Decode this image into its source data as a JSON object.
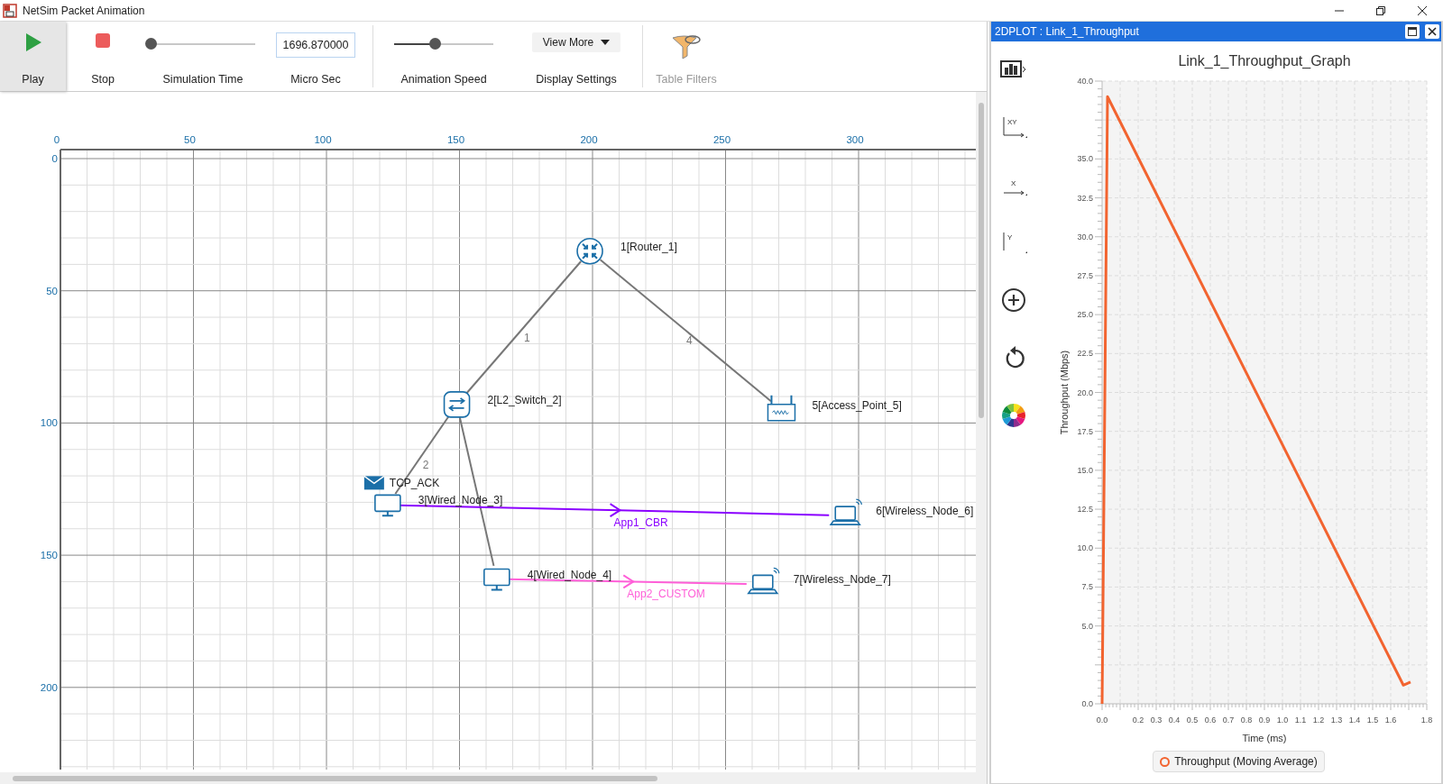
{
  "window": {
    "title": "NetSim Packet Animation"
  },
  "toolbar": {
    "play": {
      "label": "Play",
      "selected": true
    },
    "stop": {
      "label": "Stop"
    },
    "simulation_time": {
      "label": "Simulation Time",
      "level": 0
    },
    "time_field": {
      "value": "1696.870000",
      "unit": "Micro Sec"
    },
    "animation_speed": {
      "label": "Animation Speed",
      "level": 0.41
    },
    "display_settings": {
      "button": "View More",
      "label": "Display Settings"
    },
    "table_filters": {
      "label": "Table Filters",
      "disabled": true
    }
  },
  "canvas": {
    "x_ruler": [
      "0",
      "50",
      "100",
      "150",
      "200",
      "250",
      "300"
    ],
    "y_ruler": [
      "0",
      "50",
      "100",
      "150",
      "200"
    ],
    "nodes": [
      {
        "kind": "router",
        "label": "1[Router_1]"
      },
      {
        "kind": "switch",
        "label": "2[L2_Switch_2]"
      },
      {
        "kind": "wired_node",
        "label": "3[Wired_Node_3]"
      },
      {
        "kind": "wired_node",
        "label": "4[Wired_Node_4]"
      },
      {
        "kind": "access_point",
        "label": "5[Access_Point_5]"
      },
      {
        "kind": "wireless_node",
        "label": "6[Wireless_Node_6]"
      },
      {
        "kind": "wireless_node",
        "label": "7[Wireless_Node_7]"
      }
    ],
    "links": [
      {
        "label": "1"
      },
      {
        "label": "4"
      },
      {
        "label": "2"
      }
    ],
    "applications": [
      {
        "name": "App1_CBR",
        "color": "#8b00ff"
      },
      {
        "name": "App2_CUSTOM",
        "color": "#ff5fd8"
      }
    ],
    "packets": [
      {
        "label": "TCP_ACK"
      }
    ]
  },
  "plot_window": {
    "title": "2DPLOT : Link_1_Throughput",
    "tools": [
      {
        "kind": "bar_chart"
      },
      {
        "kind": "xy_axis",
        "label": "XY"
      },
      {
        "kind": "x_axis",
        "label": "X"
      },
      {
        "kind": "y_axis",
        "label": "Y"
      },
      {
        "kind": "zoom_in"
      },
      {
        "kind": "reset"
      },
      {
        "kind": "color_wheel"
      }
    ],
    "chart_data": {
      "type": "line",
      "title": "Link_1_Throughput_Graph",
      "xlabel": "Time (ms)",
      "ylabel": "Throughput (Mbps)",
      "grid": true,
      "x": [
        0,
        0.03,
        1.67,
        1.71
      ],
      "series": [
        {
          "name": "Throughput (Moving Average)",
          "color": "#f26430",
          "values": [
            0,
            39,
            1.2,
            1.4
          ]
        }
      ],
      "xlim": [
        0,
        1.8
      ],
      "ylim": [
        0,
        40
      ],
      "xticks": [
        {
          "value": 0,
          "label": "0.0"
        },
        0.2,
        0.3,
        0.4,
        0.5,
        0.6,
        0.7,
        0.8,
        0.9,
        {
          "value": 1,
          "label": "1.0"
        },
        1.1,
        1.2,
        1.3,
        1.4,
        1.5,
        1.6,
        1.8
      ],
      "yticks": [
        {
          "value": 0,
          "label": "0.0"
        },
        {
          "value": 5,
          "label": "5.0"
        },
        7.5,
        {
          "value": 10,
          "label": "10.0"
        },
        12.5,
        {
          "value": 15,
          "label": "15.0"
        },
        17.5,
        {
          "value": 20,
          "label": "20.0"
        },
        22.5,
        {
          "value": 25,
          "label": "25.0"
        },
        27.5,
        {
          "value": 30,
          "label": "30.0"
        },
        32.5,
        {
          "value": 35,
          "label": "35.0"
        },
        {
          "value": 40,
          "label": "40.0"
        }
      ]
    }
  }
}
